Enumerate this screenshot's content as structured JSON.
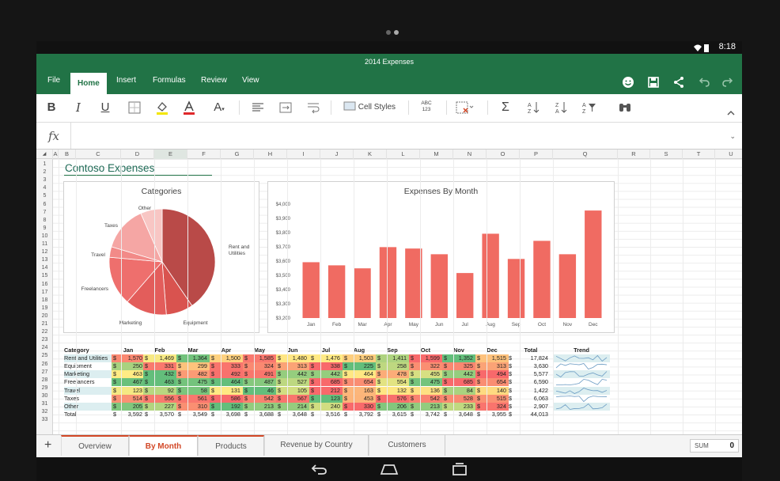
{
  "status": {
    "time": "8:18"
  },
  "app": {
    "title": "2014 Expenses"
  },
  "tabs": [
    {
      "label": "File",
      "active": false
    },
    {
      "label": "Home",
      "active": true
    },
    {
      "label": "Insert",
      "active": false
    },
    {
      "label": "Formulas",
      "active": false
    },
    {
      "label": "Review",
      "active": false
    },
    {
      "label": "View",
      "active": false
    }
  ],
  "ribbon": {
    "bold": "B",
    "italic": "I",
    "underline": "U",
    "font_size": "A",
    "cell_styles": "Cell Styles",
    "number_format": "ABC 123",
    "sum": "Σ"
  },
  "formula_bar": {
    "fx": "fx",
    "value": ""
  },
  "columns": [
    "A",
    "B",
    "C",
    "D",
    "E",
    "F",
    "G",
    "H",
    "I",
    "J",
    "K",
    "L",
    "M",
    "N",
    "O",
    "P",
    "Q",
    "R",
    "S",
    "T",
    "U"
  ],
  "selected_column": "E",
  "rows": [
    "1",
    "2",
    "3",
    "4",
    "5",
    "6",
    "7",
    "8",
    "9",
    "10",
    "11",
    "12",
    "13",
    "14",
    "15",
    "16",
    "17",
    "18",
    "19",
    "20",
    "21",
    "22",
    "23",
    "24",
    "25",
    "26",
    "27",
    "28",
    "29",
    "30",
    "31",
    "32",
    "33"
  ],
  "sheet_title": "Contoso Expenses",
  "pie_chart": {
    "title": "Categories",
    "labels": [
      "Rent and Utilities",
      "Equipment",
      "Marketing",
      "Freelancers",
      "Travel",
      "Taxes",
      "Other"
    ]
  },
  "chart_data": {
    "type": "bar",
    "title": "Expenses By Month",
    "categories": [
      "Jan",
      "Feb",
      "Mar",
      "Apr",
      "May",
      "Jun",
      "Jul",
      "Aug",
      "Sep",
      "Oct",
      "Nov",
      "Dec"
    ],
    "values": [
      3592,
      3570,
      3549,
      3698,
      3688,
      3648,
      3516,
      3792,
      3615,
      3742,
      3648,
      3955
    ],
    "ylim": [
      3200,
      4000
    ],
    "yticks": [
      "$3,200",
      "$3,300",
      "$3,400",
      "$3,500",
      "$3,600",
      "$3,700",
      "$3,800",
      "$3,900",
      "$4,000"
    ],
    "color": "#f06b62"
  },
  "table": {
    "headers": [
      "Category",
      "Jan",
      "Feb",
      "Mar",
      "Apr",
      "May",
      "Jun",
      "Jul",
      "Aug",
      "Sep",
      "Oct",
      "Nov",
      "Dec",
      "Total",
      "Trend"
    ],
    "rows": [
      {
        "category": "Rent and Utilities",
        "values": [
          "1,570",
          "1,469",
          "1,364",
          "1,500",
          "1,585",
          "1,480",
          "1,476",
          "1,503",
          "1,411",
          "1,599",
          "1,352",
          "1,515"
        ],
        "total": "17,824"
      },
      {
        "category": "Equipment",
        "values": [
          "250",
          "331",
          "299",
          "333",
          "324",
          "313",
          "338",
          "225",
          "258",
          "322",
          "325",
          "313"
        ],
        "total": "3,630"
      },
      {
        "category": "Marketing",
        "values": [
          "463",
          "432",
          "482",
          "492",
          "491",
          "442",
          "442",
          "464",
          "478",
          "455",
          "442",
          "494"
        ],
        "total": "5,577"
      },
      {
        "category": "Freelancers",
        "values": [
          "467",
          "463",
          "475",
          "464",
          "487",
          "527",
          "685",
          "654",
          "554",
          "475",
          "685",
          "654"
        ],
        "total": "6,590"
      },
      {
        "category": "Travel",
        "values": [
          "123",
          "92",
          "58",
          "131",
          "46",
          "105",
          "212",
          "163",
          "132",
          "136",
          "84",
          "140"
        ],
        "total": "1,422"
      },
      {
        "category": "Taxes",
        "values": [
          "514",
          "556",
          "561",
          "586",
          "542",
          "567",
          "123",
          "453",
          "576",
          "542",
          "528",
          "515"
        ],
        "total": "6,063"
      },
      {
        "category": "Other",
        "values": [
          "205",
          "227",
          "310",
          "192",
          "213",
          "214",
          "240",
          "330",
          "206",
          "213",
          "233",
          "324"
        ],
        "total": "2,907"
      },
      {
        "category": "Total",
        "values": [
          "3,592",
          "3,570",
          "3,549",
          "3,698",
          "3,688",
          "3,648",
          "3,516",
          "3,792",
          "3,615",
          "3,742",
          "3,648",
          "3,955"
        ],
        "total": "44,013"
      }
    ],
    "currency": "$"
  },
  "sheets": [
    {
      "label": "Overview",
      "active": false
    },
    {
      "label": "By Month",
      "active": true
    },
    {
      "label": "Products",
      "active": false
    },
    {
      "label": "Revenue by Country",
      "active": false
    },
    {
      "label": "Customers",
      "active": false
    }
  ],
  "add_sheet": "+",
  "status_sum": {
    "label": "SUM",
    "value": "0"
  }
}
